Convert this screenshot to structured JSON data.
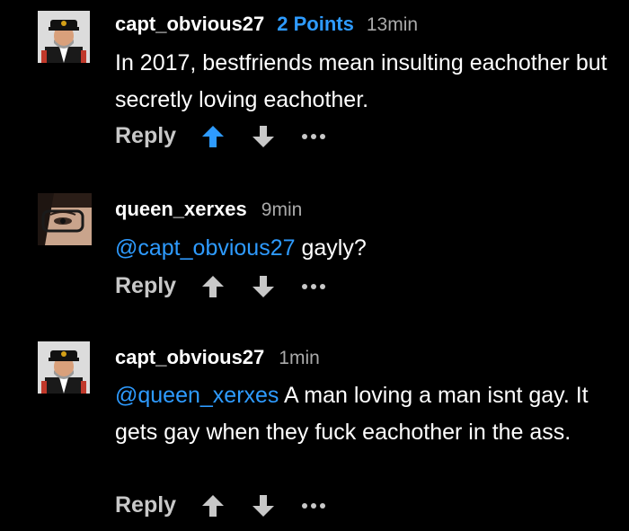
{
  "comments": [
    {
      "username": "capt_obvious27",
      "points": "2 Points",
      "time": "13min",
      "mention": "",
      "text": "In 2017, bestfriends mean insulting eachother but secretly loving eachother.",
      "reply_label": "Reply",
      "upvoted": true
    },
    {
      "username": "queen_xerxes",
      "points": "",
      "time": "9min",
      "mention": "@capt_obvious27",
      "text": " gayly?",
      "reply_label": "Reply",
      "upvoted": false
    },
    {
      "username": "capt_obvious27",
      "points": "",
      "time": "1min",
      "mention": "@queen_xerxes",
      "text": " A man loving a man isnt gay. It gets gay when they fuck eachother in the ass.",
      "reply_label": "Reply",
      "upvoted": false
    }
  ],
  "colors": {
    "background": "#000000",
    "accent": "#2e9bff",
    "muted": "#aaaaaa",
    "icon": "#c8c8c8"
  },
  "icons": {
    "upvote": "arrow-up-icon",
    "downvote": "arrow-down-icon",
    "more": "more-dots-icon"
  }
}
